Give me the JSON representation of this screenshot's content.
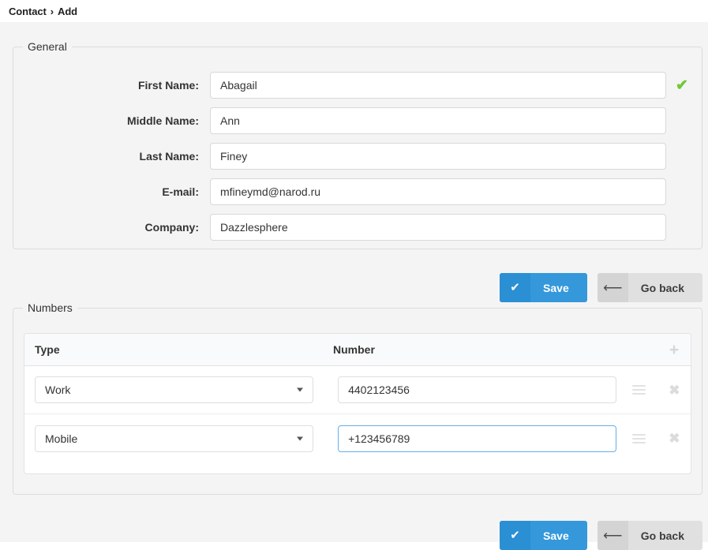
{
  "tab": {
    "parent_label": "Contact",
    "separator": "›",
    "current_label": "Add"
  },
  "general": {
    "legend": "General",
    "fields": [
      {
        "label": "First Name:",
        "value": "Abagail",
        "valid": true,
        "valid_icon": "check-icon"
      },
      {
        "label": "Middle Name:",
        "value": "Ann",
        "valid": false
      },
      {
        "label": "Last Name:",
        "value": "Finey",
        "valid": false
      },
      {
        "label": "E-mail:",
        "value": "mfineymd@narod.ru",
        "valid": false
      },
      {
        "label": "Company:",
        "value": "Dazzlesphere",
        "valid": false
      }
    ]
  },
  "numbers": {
    "legend": "Numbers",
    "columns": {
      "type": "Type",
      "number": "Number"
    },
    "add_icon": "plus-icon",
    "rows": [
      {
        "type": "Work",
        "number": "4402123456",
        "focused": false,
        "handle_icon": "drag-handle-icon",
        "remove_icon": "close-icon"
      },
      {
        "type": "Mobile",
        "number": "+123456789",
        "focused": true,
        "handle_icon": "drag-handle-icon",
        "remove_icon": "close-icon"
      }
    ]
  },
  "buttons": {
    "save_label": "Save",
    "save_icon": "check-icon",
    "back_label": "Go back",
    "back_icon": "arrow-left-icon"
  },
  "colors": {
    "accent_blue": "#3498db",
    "accent_blue_dark": "#2b8fd4",
    "valid_green": "#71c837",
    "focus_blue": "#66afe9",
    "button_gray": "#e0e0e0",
    "page_bg": "#f4f4f4"
  }
}
